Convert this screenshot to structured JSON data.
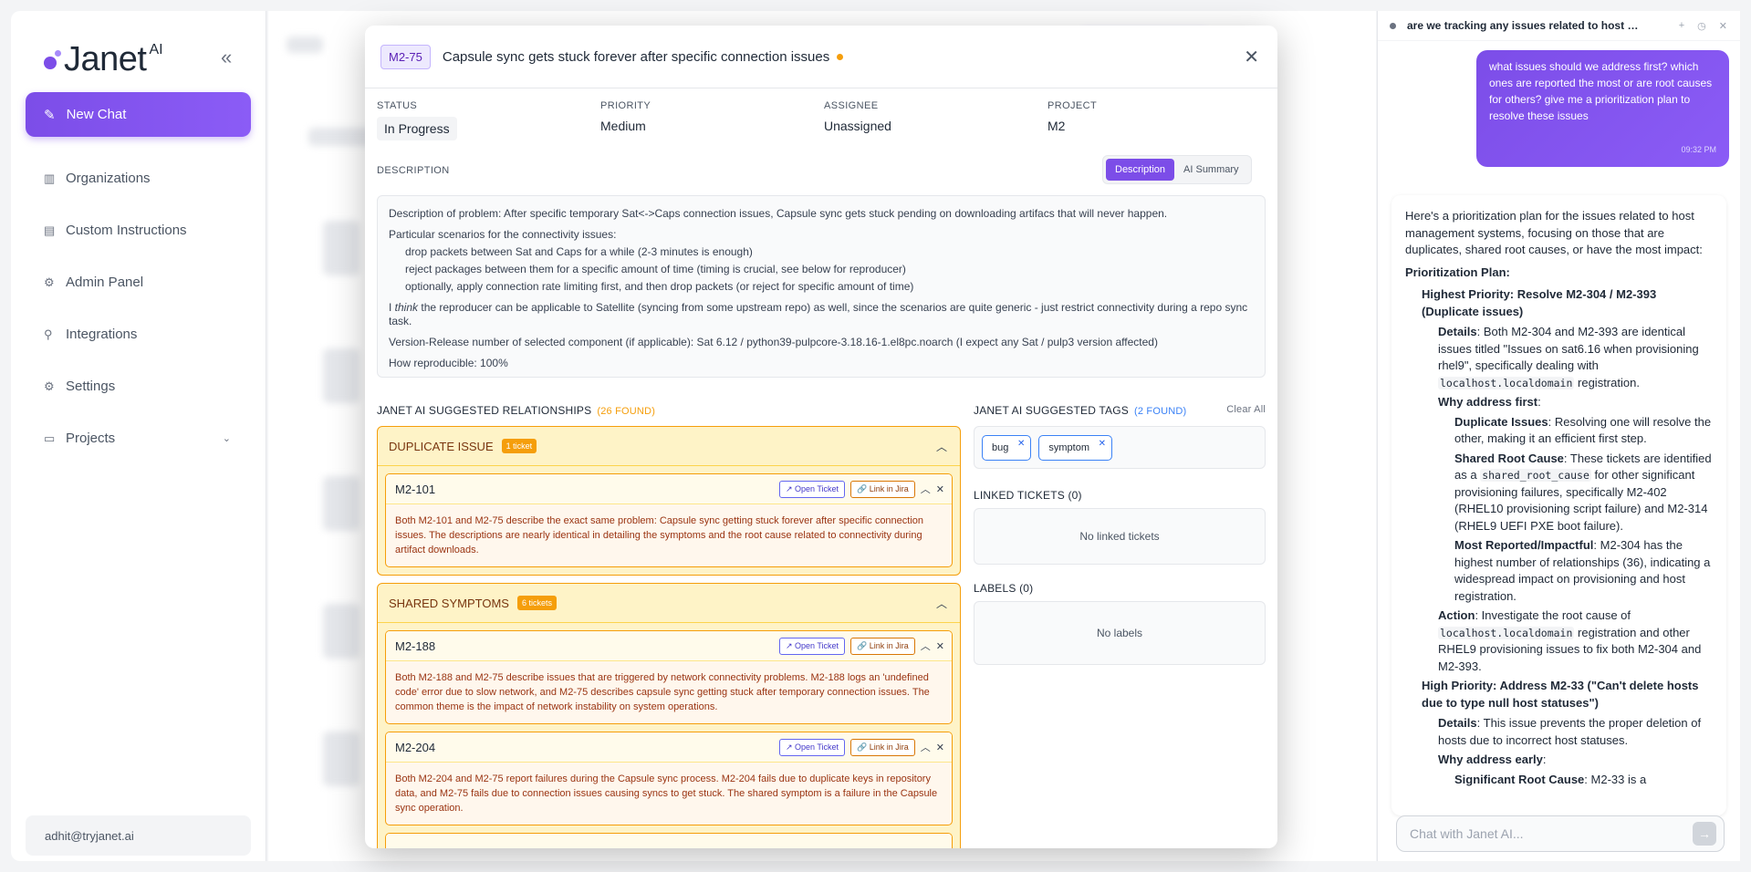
{
  "sidebar": {
    "logo": "Janet",
    "logo_sup": "AI",
    "new_chat": "New Chat",
    "items": [
      {
        "label": "Organizations"
      },
      {
        "label": "Custom Instructions"
      },
      {
        "label": "Admin Panel"
      },
      {
        "label": "Integrations"
      },
      {
        "label": "Settings"
      },
      {
        "label": "Projects"
      }
    ],
    "user_email": "adhit@tryjanet.ai"
  },
  "modal": {
    "key": "M2-75",
    "title": "Capsule sync gets stuck forever after specific connection issues",
    "fields": {
      "status_label": "STATUS",
      "status": "In Progress",
      "priority_label": "PRIORITY",
      "priority": "Medium",
      "assignee_label": "ASSIGNEE",
      "assignee": "Unassigned",
      "project_label": "PROJECT",
      "project": "M2"
    },
    "description_label": "DESCRIPTION",
    "tabs": {
      "description": "Description",
      "ai_summary": "AI Summary"
    },
    "description": {
      "p1": "Description of problem: After specific temporary Sat<->Caps connection issues, Capsule sync gets stuck pending on downloading artifacs that will never happen.",
      "p2": "Particular scenarios for the connectivity issues:",
      "b1": "drop packets between Sat and Caps for a while (2-3 minutes is enough)",
      "b2": "reject packages between them for a specific amount of time (timing is crucial, see below for reproducer)",
      "b3": "optionally, apply connection rate limiting first, and then drop packets (or reject for specific amount of time)",
      "p3_pre": "I ",
      "p3_em": "think",
      "p3_post": " the reproducer can be applicable to Satellite (syncing from some upstream repo) as well, since the scenarios are quite generic - just restrict connectivity during a repo sync task.",
      "p4": "Version-Release number of selected component (if applicable): Sat 6.12 / python39-pulpcore-3.18.16-1.el8pc.noarch (I expect any Sat / pulp3 version affected)",
      "p5": "How reproducible: 100%"
    },
    "relationships": {
      "heading": "JANET AI SUGGESTED RELATIONSHIPS",
      "count": "(26 FOUND)",
      "open_ticket": "Open Ticket",
      "link_jira": "Link in Jira",
      "groups": [
        {
          "title": "DUPLICATE ISSUE",
          "badge": "1 ticket",
          "cards": [
            {
              "id": "M2-101",
              "text": "Both M2-101 and M2-75 describe the exact same problem: Capsule sync getting stuck forever after specific connection issues. The descriptions are nearly identical in detailing the symptoms and the root cause related to connectivity during artifact downloads."
            }
          ]
        },
        {
          "title": "SHARED SYMPTOMS",
          "badge": "6 tickets",
          "cards": [
            {
              "id": "M2-188",
              "text": "Both M2-188 and M2-75 describe issues that are triggered by network connectivity problems. M2-188 logs an 'undefined code' error due to slow network, and M2-75 describes capsule sync getting stuck after temporary connection issues. The common theme is the impact of network instability on system operations."
            },
            {
              "id": "M2-204",
              "text": "Both M2-204 and M2-75 report failures during the Capsule sync process. M2-204 fails due to duplicate keys in repository data, and M2-75 fails due to connection issues causing syncs to get stuck. The shared symptom is a failure in the Capsule sync operation."
            }
          ]
        }
      ]
    },
    "tags": {
      "heading": "JANET AI SUGGESTED TAGS",
      "count": "(2 FOUND)",
      "clear_all": "Clear All",
      "items": [
        "bug",
        "symptom"
      ]
    },
    "linked": {
      "heading": "LINKED TICKETS (0)",
      "empty": "No linked tickets"
    },
    "labels": {
      "heading": "LABELS (0)",
      "empty": "No labels"
    }
  },
  "chat": {
    "title": "are we tracking any issues related to host m...",
    "user_message": "what issues should we address first? which ones are reported the most or are root causes for others? give me a prioritization plan to resolve these issues",
    "user_time": "09:32 PM",
    "ai": {
      "intro": "Here's a prioritization plan for the issues related to host management systems, focusing on those that are duplicates, shared root causes, or have the most impact:",
      "plan_title": "Prioritization Plan:",
      "h1": "Highest Priority: Resolve M2-304 / M2-393 (Duplicate issues)",
      "details_label": "Details",
      "h1_details_pre": ": Both M2-304 and M2-393 are identical issues titled \"Issues on sat6.16 when provisioning rhel9\", specifically dealing with ",
      "code1": "localhost.localdomain",
      "h1_details_post": " registration.",
      "why_first": "Why address first",
      "dup_label": "Duplicate Issues",
      "dup_text": ": Resolving one will resolve the other, making it an efficient first step.",
      "src_label": "Shared Root Cause",
      "src_pre": ": These tickets are identified as a ",
      "code2": "shared_root_cause",
      "src_post": " for other significant provisioning failures, specifically M2-402 (RHEL10 provisioning script failure) and M2-314 (RHEL9 UEFI PXE boot failure).",
      "mri_label": "Most Reported/Impactful",
      "mri_text": ": M2-304 has the highest number of relationships (36), indicating a widespread impact on provisioning and host registration.",
      "action_label": "Action",
      "action_pre": ": Investigate the root cause of ",
      "code3": "localhost.localdomain",
      "action_post": " registration and other RHEL9 provisioning issues to fix both M2-304 and M2-393.",
      "h2": "High Priority: Address M2-33 (\"Can't delete hosts due to type null host statuses\")",
      "h2_details": ": This issue prevents the proper deletion of hosts due to incorrect host statuses.",
      "why_early": "Why address early",
      "sig_label": "Significant Root Cause",
      "sig_text": ": M2-33 is a"
    },
    "input_placeholder": "Chat with Janet AI..."
  }
}
